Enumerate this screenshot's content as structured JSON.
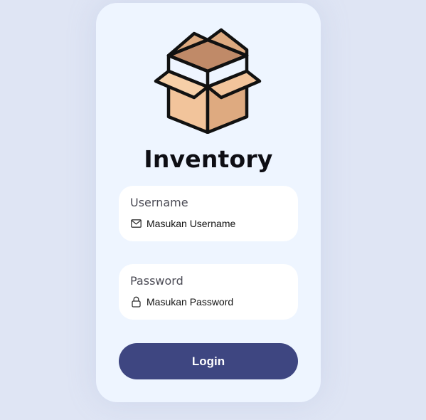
{
  "app": {
    "title": "Inventory",
    "logo_icon": "open-cardboard-box-icon"
  },
  "form": {
    "username": {
      "label": "Username",
      "placeholder": "Masukan Username",
      "value": "",
      "icon": "envelope-icon"
    },
    "password": {
      "label": "Password",
      "placeholder": "Masukan Password",
      "value": "",
      "icon": "lock-icon"
    },
    "login_label": "Login"
  },
  "colors": {
    "page_background": "#dfe5f4",
    "card_background": "#eef5ff",
    "button": "#3e4681",
    "box_light": "#f2c49b",
    "box_mid": "#deaa80",
    "box_dark": "#c08a68"
  }
}
